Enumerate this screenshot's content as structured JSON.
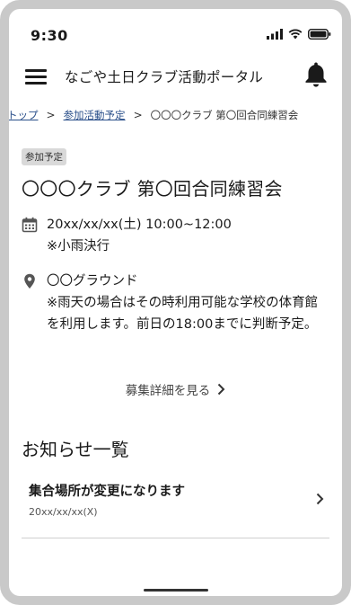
{
  "status_bar": {
    "time": "9:30"
  },
  "header": {
    "title": "なごや土日クラブ活動ポータル",
    "menu_icon": "hamburger-menu-icon",
    "notification_icon": "bell-icon"
  },
  "breadcrumb": {
    "items": [
      "トップ",
      "参加活動予定"
    ],
    "current": "〇〇〇クラブ 第〇回合同練習会",
    "separator": ">"
  },
  "event": {
    "badge": "参加予定",
    "title": "〇〇〇クラブ 第〇回合同練習会",
    "date": "20xx/xx/xx(土) 10:00~12:00",
    "date_note": "※小雨決行",
    "place": "〇〇グラウンド",
    "place_note": "※雨天の場合はその時利用可能な学校の体育館を利用します。前日の18:00までに判断予定。",
    "more_label": "募集詳細を見る"
  },
  "news": {
    "heading": "お知らせ一覧",
    "items": [
      {
        "title": "集合場所が変更になります",
        "date": "20xx/xx/xx(X)"
      }
    ]
  },
  "colors": {
    "link": "#2a4f8a",
    "badge_bg": "#d9d9d9",
    "frame": "#c9c9c9"
  }
}
